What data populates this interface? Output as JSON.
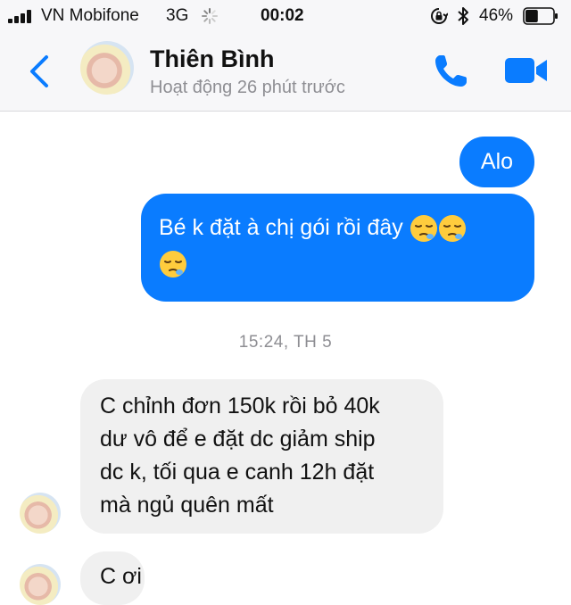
{
  "status_bar": {
    "carrier": "VN Mobifone",
    "network": "3G",
    "time": "00:02",
    "battery_percent": "46%",
    "battery_level": 0.46,
    "icons": [
      "signal-bars-icon",
      "loading-spinner-icon",
      "rotation-lock-icon",
      "bluetooth-icon",
      "battery-icon"
    ]
  },
  "header": {
    "contact_name": "Thiên Bình",
    "status_text": "Hoạt động 26 phút trước",
    "icons": [
      "back-chevron-icon",
      "phone-icon",
      "video-camera-icon"
    ]
  },
  "colors": {
    "accent": "#0a7cff",
    "incoming_bubble": "#f0f0f0",
    "muted_text": "#8e8e93"
  },
  "messages": [
    {
      "direction": "outgoing",
      "text": "Alo"
    },
    {
      "direction": "outgoing",
      "text": "Bé k đặt à chị gói rồi đây",
      "emoji": [
        "sleepy-face-emoji",
        "sleepy-face-emoji",
        "sleepy-face-emoji"
      ]
    },
    {
      "direction": "incoming",
      "lines": [
        "C chỉnh đơn 150k rồi bỏ 40k",
        "dư vô để e đặt dc giảm ship",
        "dc k, tối qua e canh 12h đặt",
        "mà ngủ quên mất"
      ]
    },
    {
      "direction": "incoming",
      "text": "C ơi"
    }
  ],
  "timestamp": "15:24, TH 5"
}
